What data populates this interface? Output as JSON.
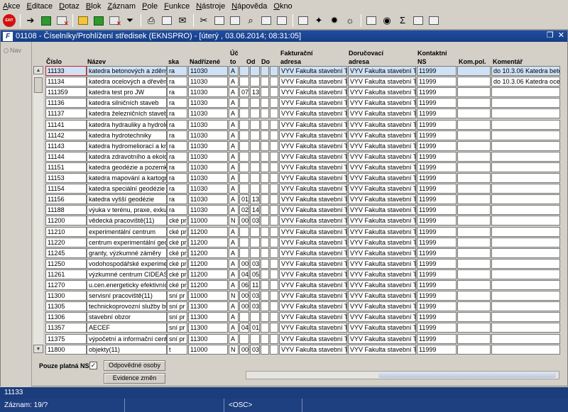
{
  "menu": [
    "Akce",
    "Editace",
    "Dotaz",
    "Blok",
    "Záznam",
    "Pole",
    "Funkce",
    "Nástroje",
    "Nápověda",
    "Okno"
  ],
  "toolbar": {
    "exit_label": "EXIT"
  },
  "window": {
    "title": "01108 - Číselníky/Prohlížení středisek (EKNSPRO) - [úterý , 03.06.2014; 08:31:05]",
    "icon_label": "F",
    "nav_label": "Nav"
  },
  "columns": {
    "cislo": "Číslo",
    "nazev": "Název",
    "ska": "ska",
    "nadrizene": "Nadřízené",
    "ucto1": "Úč",
    "ucto2": "to",
    "od": "Od",
    "do": "Do",
    "fakt1": "Fakturační",
    "fakt2": "adresa",
    "dor1": "Doručovací",
    "dor2": "adresa",
    "kont1": "Kontaktní",
    "kont2": "NS",
    "kompol": "Kom.pol.",
    "komentar": "Komentář"
  },
  "rows": [
    {
      "cislo": "11133",
      "nazev": "katedra betonových a zděný",
      "ska": "ra",
      "nadrizene": "11030",
      "ucto": "A",
      "od": "",
      "do": "",
      "fakt": "VYV Fakulta stavební Th",
      "dor": "VYV Fakulta stavební Th",
      "kont": "11999",
      "kompol": "",
      "komentar": "do 10.3.06 Katedra beto"
    },
    {
      "cislo": "11134",
      "nazev": "katedra ocelových a dřevěný",
      "ska": "ra",
      "nadrizene": "11030",
      "ucto": "A",
      "od": "",
      "do": "",
      "fakt": "VYV Fakulta stavební Th",
      "dor": "VYV Fakulta stavební Th",
      "kont": "11999",
      "kompol": "",
      "komentar": "do 10.3.06 Katedra ocelo"
    },
    {
      "cislo": "111359",
      "nazev": "katedra test pro JW",
      "ska": "ra",
      "nadrizene": "11030",
      "ucto": "A",
      "od": "07",
      "do": "13",
      "fakt": "VYV Fakulta stavební Th",
      "dor": "VYV Fakulta stavební Th",
      "kont": "11999",
      "kompol": "",
      "komentar": ""
    },
    {
      "cislo": "11136",
      "nazev": "katedra silničních staveb",
      "ska": "ra",
      "nadrizene": "11030",
      "ucto": "A",
      "od": "",
      "do": "",
      "fakt": "VYV Fakulta stavební Th",
      "dor": "VYV Fakulta stavební Th",
      "kont": "11999",
      "kompol": "",
      "komentar": ""
    },
    {
      "cislo": "11137",
      "nazev": "katedra železničních staveb",
      "ska": "ra",
      "nadrizene": "11030",
      "ucto": "A",
      "od": "",
      "do": "",
      "fakt": "VYV Fakulta stavební Th",
      "dor": "VYV Fakulta stavební Th",
      "kont": "11999",
      "kompol": "",
      "komentar": ""
    },
    {
      "cislo": "11141",
      "nazev": "katedra hydrauliky a hydrolog",
      "ska": "ra",
      "nadrizene": "11030",
      "ucto": "A",
      "od": "",
      "do": "",
      "fakt": "VYV Fakulta stavební Th",
      "dor": "VYV Fakulta stavební Th",
      "kont": "11999",
      "kompol": "",
      "komentar": ""
    },
    {
      "cislo": "11142",
      "nazev": "katedra hydrotechniky",
      "ska": "ra",
      "nadrizene": "11030",
      "ucto": "A",
      "od": "",
      "do": "",
      "fakt": "VYV Fakulta stavební Th",
      "dor": "VYV Fakulta stavební Th",
      "kont": "11999",
      "kompol": "",
      "komentar": ""
    },
    {
      "cislo": "11143",
      "nazev": "katedra hydromeliorací a kraji",
      "ska": "ra",
      "nadrizene": "11030",
      "ucto": "A",
      "od": "",
      "do": "",
      "fakt": "VYV Fakulta stavební Th",
      "dor": "VYV Fakulta stavební Th",
      "kont": "11999",
      "kompol": "",
      "komentar": ""
    },
    {
      "cislo": "11144",
      "nazev": "katedra zdravotního a ekolog",
      "ska": "ra",
      "nadrizene": "11030",
      "ucto": "A",
      "od": "",
      "do": "",
      "fakt": "VYV Fakulta stavební Th",
      "dor": "VYV Fakulta stavební Th",
      "kont": "11999",
      "kompol": "",
      "komentar": ""
    },
    {
      "cislo": "11151",
      "nazev": "katedra geodézie a pozemko",
      "ska": "ra",
      "nadrizene": "11030",
      "ucto": "A",
      "od": "",
      "do": "",
      "fakt": "VYV Fakulta stavební Th",
      "dor": "VYV Fakulta stavební Th",
      "kont": "11999",
      "kompol": "",
      "komentar": ""
    },
    {
      "cislo": "11153",
      "nazev": "katedra mapování a kartograf",
      "ska": "ra",
      "nadrizene": "11030",
      "ucto": "A",
      "od": "",
      "do": "",
      "fakt": "VYV Fakulta stavební Th",
      "dor": "VYV Fakulta stavební Th",
      "kont": "11999",
      "kompol": "",
      "komentar": ""
    },
    {
      "cislo": "11154",
      "nazev": "katedra speciální geodézie",
      "ska": "ra",
      "nadrizene": "11030",
      "ucto": "A",
      "od": "",
      "do": "",
      "fakt": "VYV Fakulta stavební Th",
      "dor": "VYV Fakulta stavební Th",
      "kont": "11999",
      "kompol": "",
      "komentar": ""
    },
    {
      "cislo": "11156",
      "nazev": "katedra vyšší geodézie",
      "ska": "ra",
      "nadrizene": "11030",
      "ucto": "A",
      "od": "01",
      "do": "13",
      "fakt": "VYV Fakulta stavební Th",
      "dor": "VYV Fakulta stavební Th",
      "kont": "11999",
      "kompol": "",
      "komentar": ""
    },
    {
      "cislo": "11188",
      "nazev": "výuka v terénu, praxe, exkur",
      "ska": "ra",
      "nadrizene": "11030",
      "ucto": "A",
      "od": "02",
      "do": "14",
      "fakt": "VYV Fakulta stavební Th",
      "dor": "VYV Fakulta stavební Th",
      "kont": "11999",
      "kompol": "",
      "komentar": ""
    },
    {
      "cislo": "11200",
      "nazev": "vědecká pracoviště(11)",
      "ska": "cké pr",
      "nadrizene": "11000",
      "ucto": "N",
      "od": "00",
      "do": "03",
      "fakt": "VYV Fakulta stavební Th",
      "dor": "VYV Fakulta stavební Th",
      "kont": "11999",
      "kompol": "",
      "komentar": ""
    },
    {
      "cislo": "11210",
      "nazev": "experimentální centrum",
      "ska": "cké pr",
      "nadrizene": "11200",
      "ucto": "A",
      "od": "",
      "do": "",
      "fakt": "VYV Fakulta stavební Th",
      "dor": "VYV Fakulta stavební Th",
      "kont": "11999",
      "kompol": "",
      "komentar": ""
    },
    {
      "cislo": "11220",
      "nazev": "centrum experimentální geote",
      "ska": "cké pr",
      "nadrizene": "11200",
      "ucto": "A",
      "od": "",
      "do": "",
      "fakt": "VYV Fakulta stavební Th",
      "dor": "VYV Fakulta stavební Th",
      "kont": "11999",
      "kompol": "",
      "komentar": ""
    },
    {
      "cislo": "11245",
      "nazev": "granty, výzkumné záměry",
      "ska": "cké pr",
      "nadrizene": "11200",
      "ucto": "A",
      "od": "",
      "do": "",
      "fakt": "VYV Fakulta stavební Th",
      "dor": "VYV Fakulta stavební Th",
      "kont": "11999",
      "kompol": "",
      "komentar": ""
    },
    {
      "cislo": "11250",
      "nazev": "vodohospodářské experimen",
      "ska": "cké pr",
      "nadrizene": "11200",
      "ucto": "A",
      "od": "00",
      "do": "03",
      "fakt": "VYV Fakulta stavební Th",
      "dor": "VYV Fakulta stavební Th",
      "kont": "11999",
      "kompol": "",
      "komentar": ""
    },
    {
      "cislo": "11261",
      "nazev": "výzkumné centrum CIDEAS",
      "ska": "cké pr",
      "nadrizene": "11200",
      "ucto": "A",
      "od": "04",
      "do": "05",
      "fakt": "VYV Fakulta stavební Th",
      "dor": "VYV Fakulta stavební Th",
      "kont": "11999",
      "kompol": "",
      "komentar": ""
    },
    {
      "cislo": "11270",
      "nazev": "u.cen.energeticky efektivních",
      "ska": "cké pr",
      "nadrizene": "11200",
      "ucto": "A",
      "od": "06",
      "do": "11",
      "fakt": "VYV Fakulta stavební Th",
      "dor": "VYV Fakulta stavební Th",
      "kont": "11999",
      "kompol": "",
      "komentar": ""
    },
    {
      "cislo": "11300",
      "nazev": "servisní pracoviště(11)",
      "ska": "sní pr",
      "nadrizene": "11000",
      "ucto": "N",
      "od": "00",
      "do": "03",
      "fakt": "VYV Fakulta stavební Th",
      "dor": "VYV Fakulta stavební Th",
      "kont": "11999",
      "kompol": "",
      "komentar": ""
    },
    {
      "cislo": "11305",
      "nazev": "technickoprovozní služby bu",
      "ska": "sní pr",
      "nadrizene": "11300",
      "ucto": "A",
      "od": "00",
      "do": "03",
      "fakt": "VYV Fakulta stavební Th",
      "dor": "VYV Fakulta stavební Th",
      "kont": "11999",
      "kompol": "",
      "komentar": ""
    },
    {
      "cislo": "11306",
      "nazev": "stavební obzor",
      "ska": "sní pr",
      "nadrizene": "11300",
      "ucto": "A",
      "od": "",
      "do": "",
      "fakt": "VYV Fakulta stavební Th",
      "dor": "VYV Fakulta stavební Th",
      "kont": "11999",
      "kompol": "",
      "komentar": ""
    },
    {
      "cislo": "11357",
      "nazev": "AECEF",
      "ska": "sní pr",
      "nadrizene": "11300",
      "ucto": "A",
      "od": "04",
      "do": "01",
      "fakt": "VYV Fakulta stavební Th",
      "dor": "VYV Fakulta stavební Th",
      "kont": "11999",
      "kompol": "",
      "komentar": ""
    },
    {
      "cislo": "11375",
      "nazev": "výpočetní a informační centr",
      "ska": "sní pr",
      "nadrizene": "11300",
      "ucto": "A",
      "od": "",
      "do": "",
      "fakt": "VYV Fakulta stavební Th",
      "dor": "VYV Fakulta stavební Th",
      "kont": "11999",
      "kompol": "",
      "komentar": ""
    },
    {
      "cislo": "11800",
      "nazev": "objekty(11)",
      "ska": "t",
      "nadrizene": "11000",
      "ucto": "N",
      "od": "00",
      "do": "03",
      "fakt": "VYV Fakulta stavební Th",
      "dor": "VYV Fakulta stavební Th",
      "kont": "11999",
      "kompol": "",
      "komentar": ""
    }
  ],
  "bottom": {
    "platna_label": "Pouze platná NS",
    "checkbox_mark": "✓",
    "btn_osoby": "Odpovědné osoby",
    "btn_zmeny": "Evidence změn"
  },
  "status": {
    "field_value": "11133",
    "record": "Záznam: 19/?",
    "mode": "<OSC>"
  }
}
